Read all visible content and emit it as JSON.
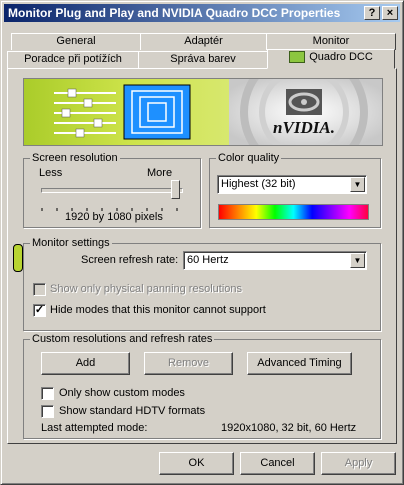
{
  "window": {
    "title": "Monitor Plug and Play and NVIDIA Quadro DCC Properties",
    "help_label": "?",
    "close_label": "×"
  },
  "tabs": {
    "row1": [
      "General",
      "Adaptér",
      "Monitor"
    ],
    "row2": [
      "Poradce při potížích",
      "Správa barev",
      "Quadro DCC"
    ]
  },
  "banner": {
    "brand": "nVIDIA."
  },
  "resolution": {
    "legend": "Screen resolution",
    "less": "Less",
    "more": "More",
    "value": "1920 by 1080 pixels",
    "slider_position": 1.0
  },
  "color": {
    "legend": "Color quality",
    "selected": "Highest (32 bit)"
  },
  "monitor_settings": {
    "legend": "Monitor settings",
    "refresh_label": "Screen refresh rate:",
    "refresh_value": "60 Hertz",
    "panning_label": "Show only physical panning resolutions",
    "hide_modes_label": "Hide modes that this monitor cannot support",
    "hide_modes_checked": true
  },
  "custom": {
    "legend": "Custom resolutions and refresh rates",
    "add_label": "Add",
    "remove_label": "Remove",
    "advanced_label": "Advanced Timing",
    "only_custom_label": "Only show custom modes",
    "hdtv_label": "Show standard HDTV formats",
    "last_mode_label": "Last attempted mode:",
    "last_mode_value": "1920x1080, 32 bit, 60 Hertz"
  },
  "footer": {
    "ok_label": "OK",
    "cancel_label": "Cancel",
    "apply_label": "Apply"
  },
  "colors": {
    "title_start": "#0a246a",
    "title_end": "#a6caf0",
    "banner_green": "#b8d432",
    "window_bg": "#d4d0c8"
  }
}
